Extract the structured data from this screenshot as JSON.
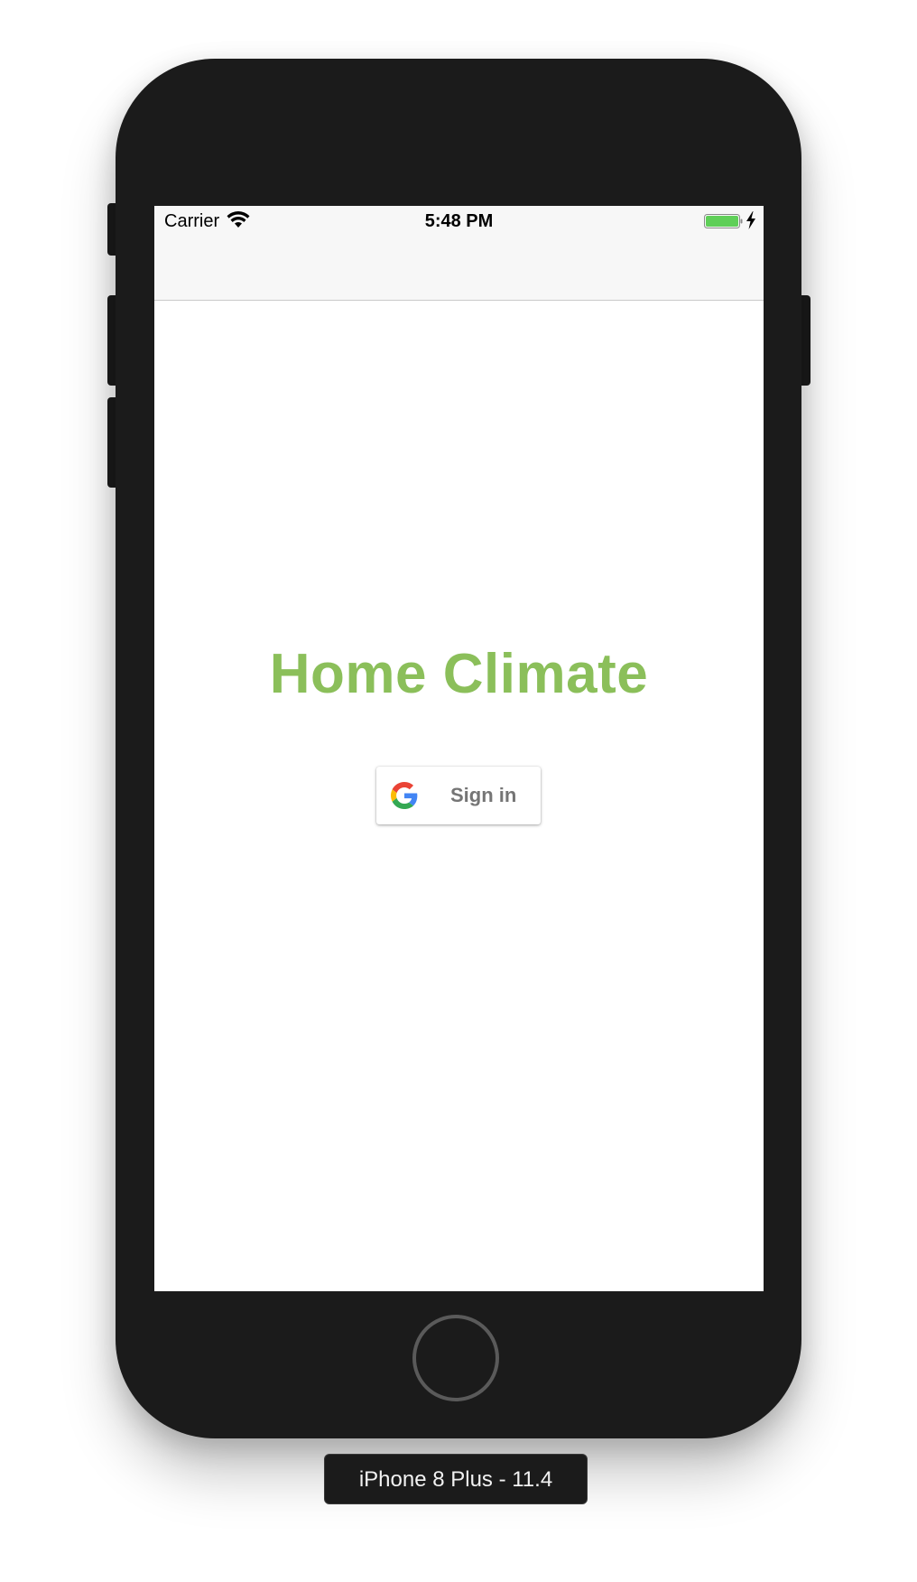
{
  "status_bar": {
    "carrier": "Carrier",
    "time": "5:48 PM",
    "icons": [
      "wifi-icon",
      "battery-icon",
      "charging-bolt-icon"
    ]
  },
  "app": {
    "title": "Home Climate",
    "title_color": "#8bbf5a",
    "signin_button": {
      "label": "Sign in",
      "icon": "google-g-icon"
    }
  },
  "simulator": {
    "device_label": "iPhone 8 Plus - 11.4"
  },
  "colors": {
    "navbar_bg": "#f7f7f7",
    "device_body": "#1b1b1b",
    "button_text": "#757575"
  }
}
